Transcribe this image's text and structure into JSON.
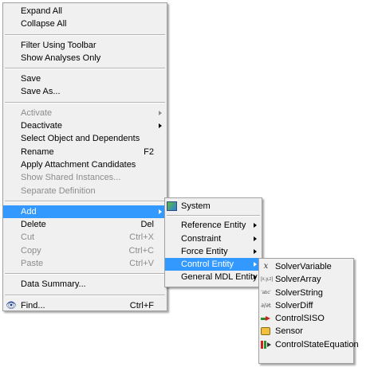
{
  "main_menu": {
    "items": [
      {
        "label": "Expand All"
      },
      {
        "label": "Collapse All"
      },
      {
        "label": "Filter Using Toolbar"
      },
      {
        "label": "Show Analyses Only"
      },
      {
        "label": "Save"
      },
      {
        "label": "Save As..."
      },
      {
        "label": "Activate"
      },
      {
        "label": "Deactivate"
      },
      {
        "label": "Select Object and Dependents"
      },
      {
        "label": "Rename",
        "shortcut": "F2"
      },
      {
        "label": "Apply Attachment Candidates"
      },
      {
        "label": "Show Shared Instances..."
      },
      {
        "label": "Separate Definition"
      },
      {
        "label": "Add"
      },
      {
        "label": "Delete",
        "shortcut": "Del"
      },
      {
        "label": "Cut",
        "shortcut": "Ctrl+X"
      },
      {
        "label": "Copy",
        "shortcut": "Ctrl+C"
      },
      {
        "label": "Paste",
        "shortcut": "Ctrl+V"
      },
      {
        "label": "Data Summary..."
      },
      {
        "label": "Find...",
        "shortcut": "Ctrl+F",
        "icon": "binoculars-icon"
      }
    ]
  },
  "add_submenu": {
    "items": [
      {
        "label": "System",
        "icon": "system-icon"
      },
      {
        "label": "Reference Entity"
      },
      {
        "label": "Constraint"
      },
      {
        "label": "Force Entity"
      },
      {
        "label": "Control Entity"
      },
      {
        "label": "General MDL Entity"
      }
    ]
  },
  "control_entity_submenu": {
    "items": [
      {
        "label": "SolverVariable",
        "icon": "solver-variable-icon",
        "icon_text": "𝑥"
      },
      {
        "label": "SolverArray",
        "icon": "solver-array-icon",
        "icon_text": "[x,y,z]"
      },
      {
        "label": "SolverString",
        "icon": "solver-string-icon",
        "icon_text": "'abc'"
      },
      {
        "label": "SolverDiff",
        "icon": "solver-diff-icon",
        "icon_text": "∂/∂t"
      },
      {
        "label": "ControlSISO",
        "icon": "control-siso-icon"
      },
      {
        "label": "Sensor",
        "icon": "sensor-icon"
      },
      {
        "label": "ControlStateEquation",
        "icon": "control-state-equation-icon"
      }
    ]
  },
  "colors": {
    "highlight": "#3399ff",
    "menu_background": "#f0f0f0",
    "disabled_text": "#8c8c8c"
  }
}
